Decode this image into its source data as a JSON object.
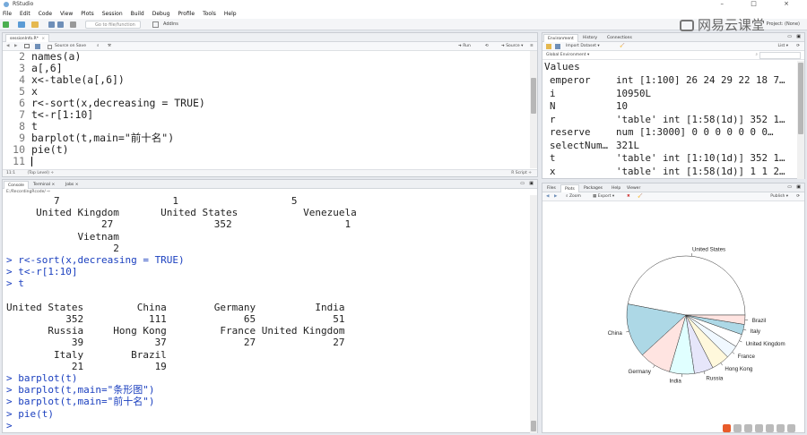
{
  "app": {
    "title": "RStudio"
  },
  "window_controls": [
    "–",
    "□",
    "×"
  ],
  "menu": [
    "File",
    "Edit",
    "Code",
    "View",
    "Plots",
    "Session",
    "Build",
    "Debug",
    "Profile",
    "Tools",
    "Help"
  ],
  "toolbar": {
    "go_to_function": "Go to file/function",
    "addins": "Addins",
    "project": "Project: (None)"
  },
  "watermark": "网易云课堂",
  "editor": {
    "tab": "sessionInfo.R*",
    "source_on_save": "Source on Save",
    "run": "Run",
    "source": "Source",
    "lines": [
      {
        "n": "2",
        "code": "names(a)"
      },
      {
        "n": "3",
        "code": "a[,6]"
      },
      {
        "n": "4",
        "code": "x<-table(a[,6])"
      },
      {
        "n": "5",
        "code": "x"
      },
      {
        "n": "6",
        "code": "r<-sort(x,decreasing = TRUE)"
      },
      {
        "n": "7",
        "code": "t<-r[1:10]"
      },
      {
        "n": "8",
        "code": "t"
      },
      {
        "n": "9",
        "code": "barplot(t,main=\"前十名\")"
      },
      {
        "n": "10",
        "code": "pie(t)"
      },
      {
        "n": "11",
        "code": ""
      }
    ],
    "status_pos": "11:1",
    "status_scope": "(Top Level) ÷",
    "status_lang": "R Script ÷"
  },
  "console": {
    "tabs": [
      "Console",
      "Terminal",
      "Jobs"
    ],
    "path": "E:/RecordingRcode/ ⇨",
    "lines": [
      "        7                   1                   5",
      "     United Kingdom       United States           Venezuela",
      "                27                 352                   1",
      "            Vietnam",
      "                  2",
      "> r<-sort(x,decreasing = TRUE)",
      "> t<-r[1:10]",
      "> t",
      "",
      "United States         China        Germany          India",
      "          352           111             65             51",
      "       Russia     Hong Kong         France United Kingdom",
      "           39            37             27             27",
      "        Italy        Brazil",
      "           21            19",
      "> barplot(t)",
      "> barplot(t,main=\"条形图\")",
      "> barplot(t,main=\"前十名\")",
      "> pie(t)",
      "> "
    ]
  },
  "environment": {
    "tabs": [
      "Environment",
      "History",
      "Connections"
    ],
    "import_label": "Import Dataset ▾",
    "list_label": "List ▾",
    "scope": "Global Environment ▾",
    "section": "Values",
    "rows": [
      {
        "name": "emperor",
        "value": "int [1:100] 26 24 29 22 18 7…"
      },
      {
        "name": "i",
        "value": "10950L"
      },
      {
        "name": "N",
        "value": "10"
      },
      {
        "name": "r",
        "value": "'table' int [1:58(1d)] 352 1…"
      },
      {
        "name": "reserve",
        "value": "num [1:3000] 0 0 0 0 0 0 0…"
      },
      {
        "name": "selectNum…",
        "value": "321L"
      },
      {
        "name": "t",
        "value": "'table' int [1:10(1d)] 352 1…"
      },
      {
        "name": "x",
        "value": "'table' int [1:58(1d)] 1 1 2…"
      }
    ]
  },
  "plots": {
    "tabs": [
      "Files",
      "Plots",
      "Packages",
      "Help",
      "Viewer"
    ],
    "zoom": "Zoom",
    "export": "Export ▾",
    "publish": "Publish ▾"
  },
  "chart_data": {
    "type": "pie",
    "categories": [
      "United States",
      "China",
      "Germany",
      "India",
      "Russia",
      "Hong Kong",
      "France",
      "United Kingdom",
      "Italy",
      "Brazil"
    ],
    "values": [
      352,
      111,
      65,
      51,
      39,
      37,
      27,
      27,
      21,
      19
    ],
    "colors": [
      "#ffffff",
      "#add8e6",
      "#ffe4e1",
      "#e0ffff",
      "#e6e6fa",
      "#fff8dc",
      "#f0f8ff",
      "#ffffff",
      "#add8e6",
      "#ffe4e1"
    ]
  }
}
